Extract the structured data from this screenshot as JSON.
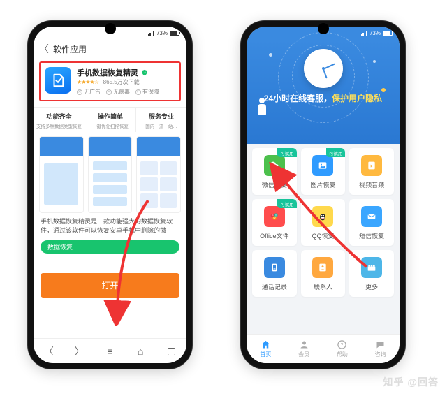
{
  "status": {
    "battery": "73%",
    "battery_icon": "73"
  },
  "left": {
    "back_label": "软件应用",
    "app": {
      "title": "手机数据恢复精灵",
      "stars": "★★★★☆",
      "download_count": "865.5万次下载",
      "tags": [
        "无广告",
        "无病毒",
        "有保障"
      ]
    },
    "features": [
      {
        "title": "功能齐全",
        "sub": "支持多种数据类型恢复"
      },
      {
        "title": "操作简单",
        "sub": "一键优化扫描恢复"
      },
      {
        "title": "服务专业",
        "sub": "国内一流一站…"
      }
    ],
    "desc": "手机数据恢复精灵是一款功能强大的数据恢复软件，通过该软件可以恢复安卓手机中删除的微",
    "pill": "数据恢复",
    "open_btn": "打开"
  },
  "right": {
    "slogan_a": "24小时在线客服，",
    "slogan_b": "保护用户隐私",
    "badge": "可试用",
    "cells": [
      {
        "label": "微信恢复",
        "try": true
      },
      {
        "label": "图片恢复",
        "try": true
      },
      {
        "label": "视频音频",
        "try": false
      },
      {
        "label": "Office文件",
        "try": true
      },
      {
        "label": "QQ恢复",
        "try": false
      },
      {
        "label": "短信恢复",
        "try": false
      },
      {
        "label": "通话记录",
        "try": false
      },
      {
        "label": "联系人",
        "try": false
      },
      {
        "label": "更多",
        "try": false
      }
    ],
    "tabs": [
      "首页",
      "会员",
      "帮助",
      "咨询"
    ]
  },
  "watermark": "知乎 @回答"
}
